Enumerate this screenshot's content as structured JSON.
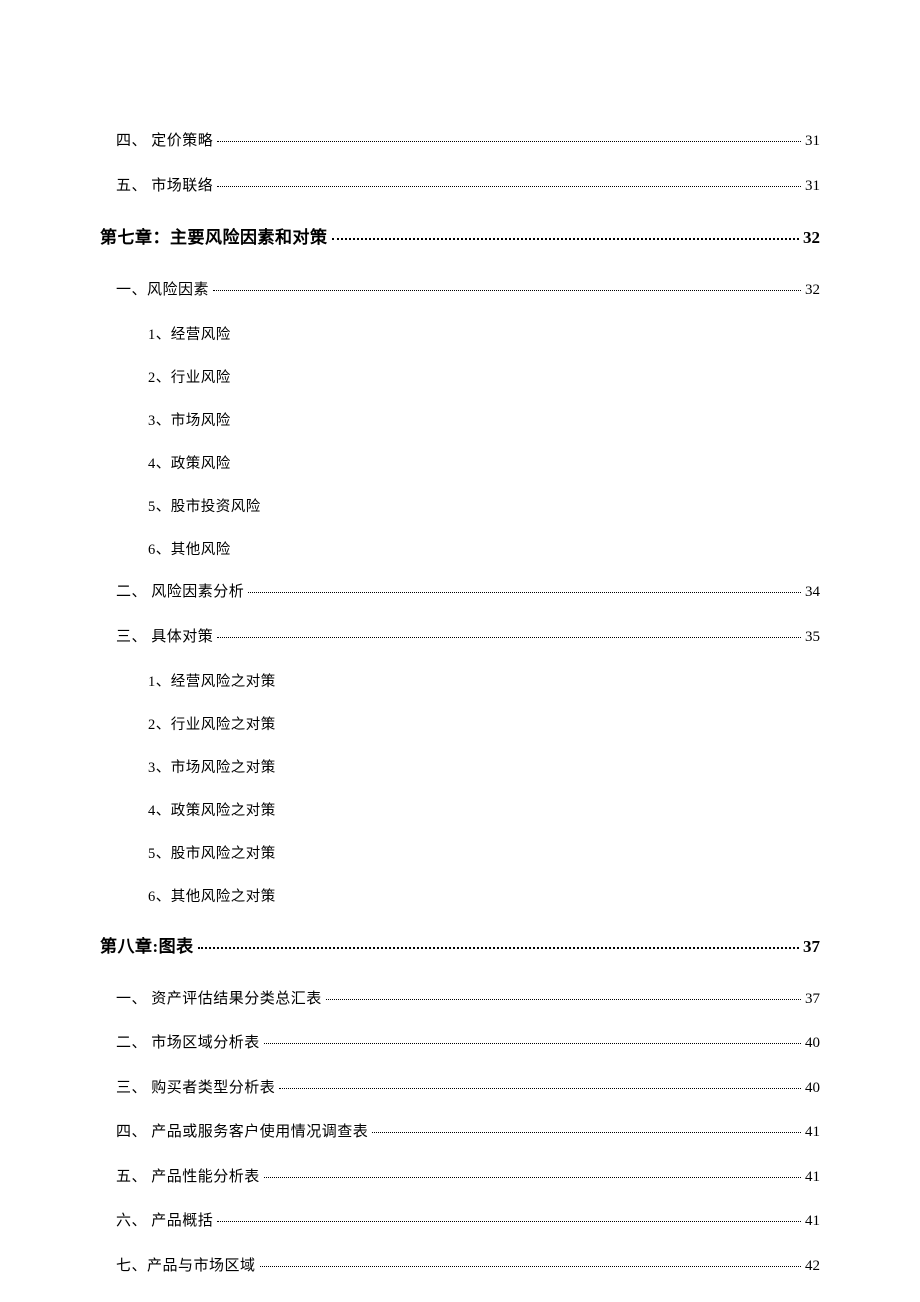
{
  "entries": [
    {
      "type": "line",
      "indent": 1,
      "label": "四、 定价策略",
      "page": "31"
    },
    {
      "type": "line",
      "indent": 1,
      "label": "五、 市场联络",
      "page": "31"
    },
    {
      "type": "chapter",
      "label": "第七章：主要风险因素和对策",
      "page": "32"
    },
    {
      "type": "line",
      "indent": 1,
      "label": "一、风险因素",
      "page": "32"
    },
    {
      "type": "sub",
      "label": "1、经营风险"
    },
    {
      "type": "sub",
      "label": "2、行业风险"
    },
    {
      "type": "sub",
      "label": "3、市场风险"
    },
    {
      "type": "sub",
      "label": "4、政策风险"
    },
    {
      "type": "sub",
      "label": "5、股市投资风险"
    },
    {
      "type": "sub",
      "label": "6、其他风险"
    },
    {
      "type": "line",
      "indent": 1,
      "label": "二、 风险因素分析",
      "page": "34"
    },
    {
      "type": "line",
      "indent": 1,
      "label": "三、 具体对策",
      "page": "35"
    },
    {
      "type": "sub",
      "label": "1、经营风险之对策"
    },
    {
      "type": "sub",
      "label": "2、行业风险之对策"
    },
    {
      "type": "sub",
      "label": "3、市场风险之对策"
    },
    {
      "type": "sub",
      "label": "4、政策风险之对策"
    },
    {
      "type": "sub",
      "label": "5、股市风险之对策"
    },
    {
      "type": "sub",
      "label": "6、其他风险之对策"
    },
    {
      "type": "chapter",
      "label": "第八章:图表",
      "page": "37"
    },
    {
      "type": "line",
      "indent": 1,
      "label": "一、 资产评估结果分类总汇表",
      "page": "37"
    },
    {
      "type": "line",
      "indent": 1,
      "label": "二、 市场区域分析表",
      "page": "40"
    },
    {
      "type": "line",
      "indent": 1,
      "label": "三、 购买者类型分析表",
      "page": "40"
    },
    {
      "type": "line",
      "indent": 1,
      "label": "四、 产品或服务客户使用情况调查表",
      "page": "41"
    },
    {
      "type": "line",
      "indent": 1,
      "label": "五、 产品性能分析表",
      "page": "41"
    },
    {
      "type": "line",
      "indent": 1,
      "label": "六、 产品概括",
      "page": "41"
    },
    {
      "type": "line",
      "indent": 1,
      "label": "七、产品与市场区域",
      "page": "42"
    }
  ]
}
